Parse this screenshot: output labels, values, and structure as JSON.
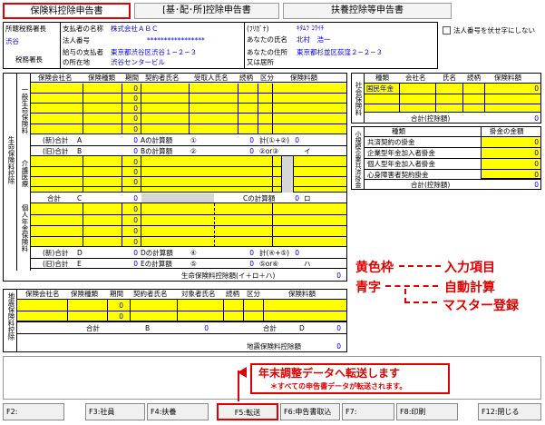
{
  "tabs": [
    {
      "label": "保険料控除申告書",
      "active": true
    },
    {
      "label": "[基･配･所]控除申告書",
      "active": false
    },
    {
      "label": "扶養控除等申告書",
      "active": false
    }
  ],
  "header": {
    "office_label": "所轄税務署長",
    "office_value": "渋谷",
    "office_suffix": "税務署長",
    "payer_name_label": "支払者の名称",
    "payer_name_value": "株式会社ＡＢＣ",
    "corp_no_label": "法人番号",
    "corp_no_value": "*****************",
    "payer_addr_label1": "給与の支払者",
    "payer_addr_label2": "の所在地",
    "payer_addr_value1": "東京都渋谷区渋谷１−２−３",
    "payer_addr_value2": "渋谷センタービル",
    "kana_label": "(ﾌﾘｶﾞﾅ)",
    "kana_value": "ｷﾀﾑﾗ ｺｳｲﾁ",
    "name_label": "あなたの氏名",
    "name_value": "北村　浩一",
    "addr_label1": "あなたの住所",
    "addr_label2": "又は居所",
    "addr_value": "東京都杉並区荻窪２−２−３",
    "no_print_label": "法人番号を伏せ字にしない"
  },
  "life": {
    "section_label": "生命保険料控除",
    "general_label": "一般生命保険料",
    "medical_label": "介護医療",
    "pension_label": "個人年金保険料",
    "headers": [
      "保険会社名",
      "保険種類",
      "期間",
      "契約者氏名",
      "受取人氏名",
      "続柄",
      "区分",
      "保険料額"
    ],
    "zero": "0",
    "rows": {
      "gen_new": "(新)合計",
      "gen_a": "A",
      "gen_a_calc": "Aの計算額",
      "gen_old": "(旧)合計",
      "gen_b": "B",
      "gen_b_calc": "Bの計算額",
      "gen_sum_label": "計(①+②)",
      "gen_sum_i": "イ",
      "gen_or": "②or③",
      "med_total": "合計",
      "med_c": "C",
      "med_c_calc": "Cの計算額",
      "med_ro": "ロ",
      "pen_new": "(新)合計",
      "pen_d": "D",
      "pen_d_calc": "Dの計算額",
      "pen_old": "(旧)合計",
      "pen_e": "E",
      "pen_e_calc": "Eの計算額",
      "pen_sum_label": "計(④+⑤)",
      "pen_ha": "ハ",
      "pen_or": "⑤or⑥",
      "grand_total": "生命保険料控除額(イ＋ロ＋ハ)",
      "circ1": "①",
      "circ2": "②",
      "circ3": "③",
      "circ4": "④",
      "circ5": "⑤",
      "circ6": "⑥"
    }
  },
  "social": {
    "section_label": "社会保険料",
    "headers": [
      "種類",
      "会社名",
      "氏名",
      "続柄",
      "保険料額"
    ],
    "row1_type": "国民年金",
    "row1_value": "0",
    "total_label": "合計(控除額)",
    "total_value": "0"
  },
  "small": {
    "section_label": "小規模企業共済掛金",
    "headers": [
      "種類",
      "掛金の金額"
    ],
    "items": [
      "共済契約の掛金",
      "企業型年金加入者掛金",
      "個人型年金加入者掛金",
      "心身障害者契約掛金"
    ],
    "values": [
      "0",
      "0",
      "0",
      "0"
    ],
    "total_label": "合計(控除額)",
    "total_value": "0"
  },
  "quake": {
    "section_label": "地震保険料控除",
    "headers": [
      "保険会社名",
      "保険種類",
      "期間",
      "契約者氏名",
      "対象者氏名",
      "続柄",
      "区分",
      "保険料額"
    ],
    "zero": "0",
    "total_label": "合計",
    "b_label": "B",
    "total_label2": "合計",
    "total_d": "D",
    "deduction_label": "地震保険料控除額"
  },
  "legend": {
    "yellow": "黄色枠",
    "yellow_desc": "入力項目",
    "blue": "青字",
    "blue_desc1": "自動計算",
    "blue_desc2": "マスター登録"
  },
  "notice": {
    "main": "年末調整データへ転送します",
    "sub": "＊すべての申告書データが転送されます。"
  },
  "fkeys": [
    "F2:",
    "F3:社員",
    "F4:扶養",
    "F5:転送",
    "F6:申告書取込",
    "F7:",
    "F8:印刷",
    "F12:閉じる"
  ],
  "colors": {
    "input": "#ffff00",
    "auto": "#0000ee",
    "highlight": "#e00000"
  }
}
